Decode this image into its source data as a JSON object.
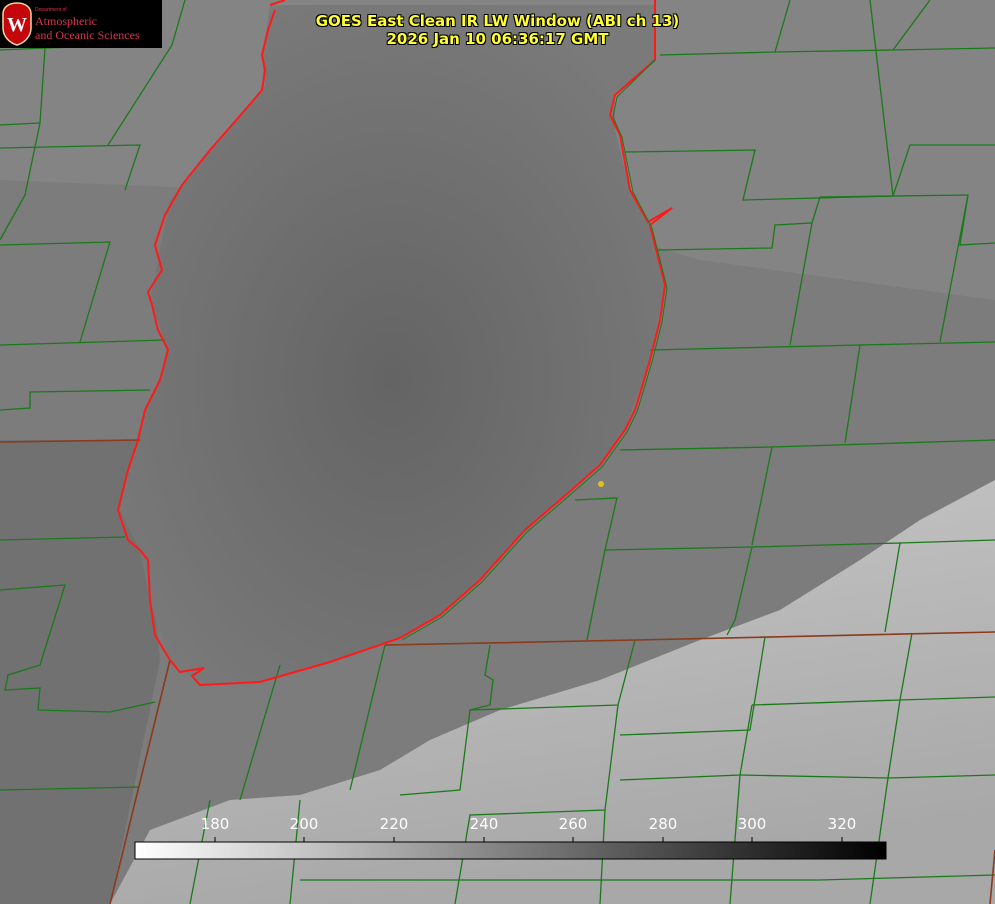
{
  "title": {
    "line1": "GOES East Clean IR LW Window (ABI ch 13)",
    "line2": "2026 Jan 10 06:36:17 GMT"
  },
  "logo": {
    "department": "Department of",
    "line1": "Atmospheric",
    "line2": "and Oceanic Sciences",
    "crest_letter": "W",
    "crest_color": "#c5050c",
    "text_color": "#d8344f"
  },
  "colorbar": {
    "tick_values": [
      180,
      200,
      220,
      240,
      260,
      280,
      300,
      320
    ],
    "tick_labels": [
      "180",
      "200",
      "220",
      "240",
      "260",
      "280",
      "300",
      "320"
    ],
    "gradient_start_color": "#ffffff",
    "gradient_end_color": "#000000"
  },
  "map_colors": {
    "county_lines": "#1a7a1a",
    "state_lines": "#8b3a1a",
    "lake_outline": "#ff1a1a",
    "station_marker": "#e0c020",
    "cloud_dark": "#6a6a6a",
    "cloud_light": "#c4c4c4"
  }
}
